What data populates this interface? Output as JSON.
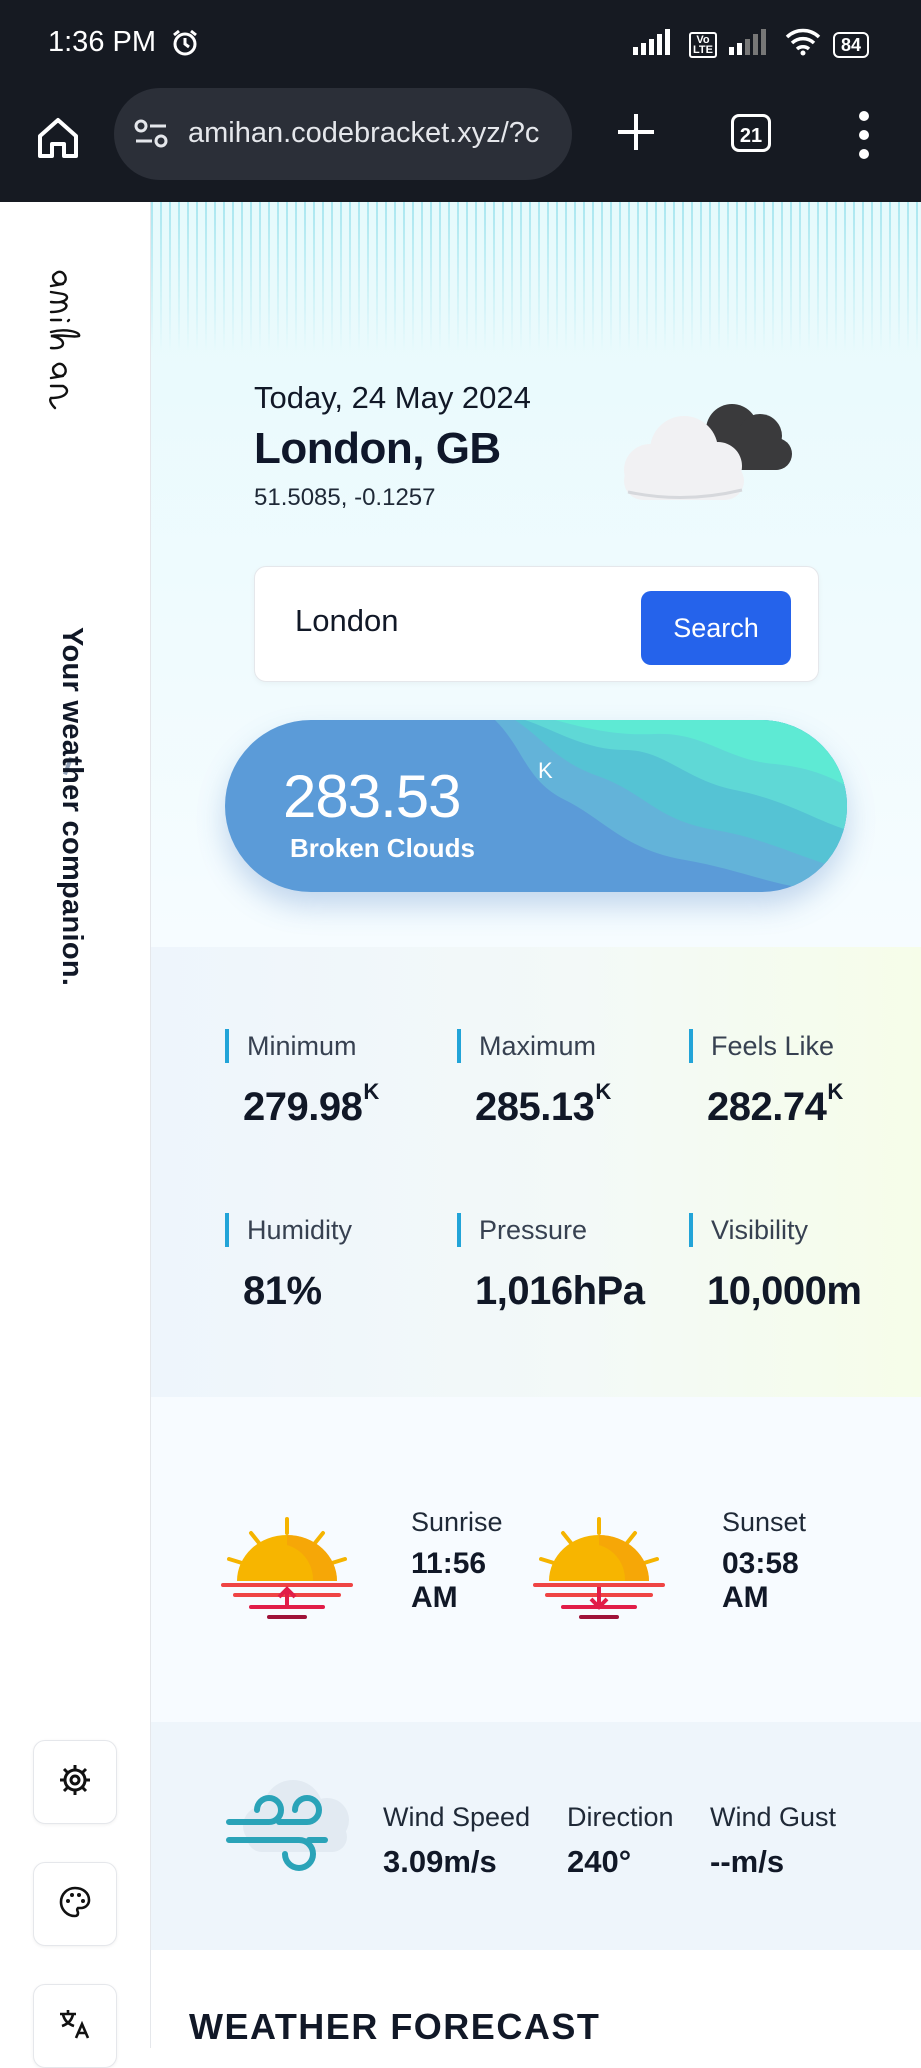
{
  "status_bar": {
    "time": "1:36 PM",
    "battery": "84",
    "volte": "Vo LTE"
  },
  "browser": {
    "url": "amihan.codebracket.xyz/?c",
    "tab_count": "21"
  },
  "sidebar": {
    "tagline": "Your weather companion."
  },
  "weather": {
    "date_prefix": "Today,",
    "date": " 24 May 2024",
    "city": "London, GB",
    "coordinates": "51.5085, -0.1257",
    "search_value": "London",
    "search_button": "Search",
    "temperature": "283.53",
    "temperature_unit": "K",
    "description": "Broken Clouds"
  },
  "stats": [
    {
      "label": "Minimum",
      "value": "279.98",
      "unit": "K"
    },
    {
      "label": "Maximum",
      "value": "285.13",
      "unit": "K"
    },
    {
      "label": "Feels Like",
      "value": "282.74",
      "unit": "K"
    },
    {
      "label": "Humidity",
      "value": "81%",
      "unit": ""
    },
    {
      "label": "Pressure",
      "value": "1,016hPa",
      "unit": ""
    },
    {
      "label": "Visibility",
      "value": "10,000m",
      "unit": ""
    }
  ],
  "sun": {
    "sunrise_label": "Sunrise",
    "sunrise_time": "11:56 AM",
    "sunset_label": "Sunset",
    "sunset_time": "03:58 AM"
  },
  "wind": {
    "speed_label": "Wind Speed",
    "speed_value": "3.09m/s",
    "direction_label": "Direction",
    "direction_value": "240°",
    "gust_label": "Wind Gust",
    "gust_value": "--m/s"
  },
  "forecast": {
    "title": "WEATHER FORECAST"
  },
  "colors": {
    "accent": "#2563eb",
    "stat_bar": "#22a4d8",
    "pill": "#5b9bd8",
    "wave": "#5eead4"
  }
}
